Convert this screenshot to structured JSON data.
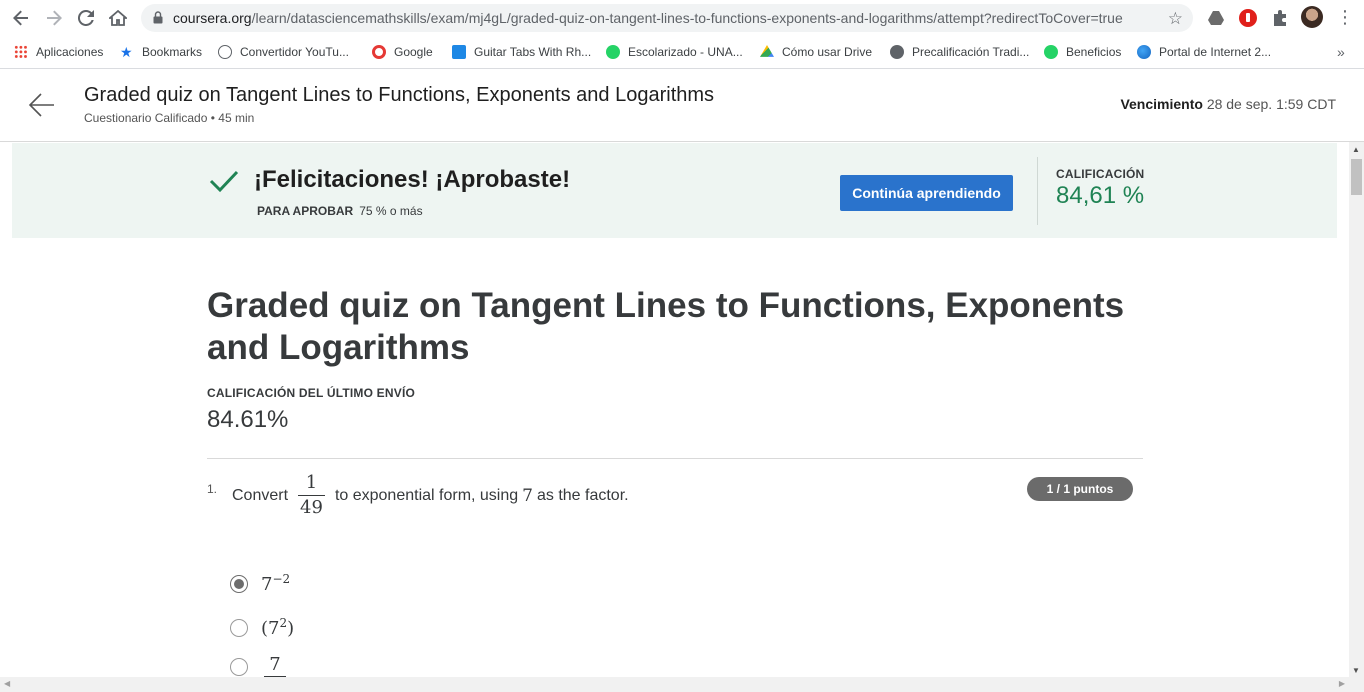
{
  "browser": {
    "url_domain": "coursera.org",
    "url_path": "/learn/datasciencemathskills/exam/mj4gL/graded-quiz-on-tangent-lines-to-functions-exponents-and-logarithms/attempt?redirectToCover=true"
  },
  "bookmarks": [
    {
      "label": "Aplicaciones",
      "icon": "apps-grid-icon",
      "color": "#4285f4"
    },
    {
      "label": "Bookmarks",
      "icon": "star-icon",
      "color": "#1a73e8"
    },
    {
      "label": "Convertidor YouTu...",
      "icon": "converter-icon",
      "color": "#5f6368"
    },
    {
      "label": "Google",
      "icon": "opera-icon",
      "color": "#e53935"
    },
    {
      "label": "Guitar Tabs With Rh...",
      "icon": "tabs-icon",
      "color": "#1e88e5"
    },
    {
      "label": "Escolarizado - UNA...",
      "icon": "whatsapp-icon",
      "color": "#25d366"
    },
    {
      "label": "Cómo usar Drive",
      "icon": "drive-icon",
      "color": "#fbbc04"
    },
    {
      "label": "Precalificación Tradi...",
      "icon": "globe-icon",
      "color": "#5f6368"
    },
    {
      "label": "Beneficios",
      "icon": "whatsapp-icon",
      "color": "#25d366"
    },
    {
      "label": "Portal de Internet 2...",
      "icon": "earth-icon",
      "color": "#1e88e5"
    }
  ],
  "header": {
    "title": "Graded quiz on Tangent Lines to Functions, Exponents and Logarithms",
    "subtitle": "Cuestionario Calificado • 45 min",
    "due_label": "Vencimiento",
    "due_value": "28 de sep. 1:59 CDT"
  },
  "banner": {
    "title": "¡Felicitaciones! ¡Aprobaste!",
    "pass_label": "PARA APROBAR",
    "pass_value": "75 % o más",
    "button": "Continúa aprendiendo",
    "grade_label": "CALIFICACIÓN",
    "grade_value": "84,61 %",
    "accent": "#1f8354",
    "button_color": "#2a73cc"
  },
  "quiz": {
    "title": "Graded quiz on Tangent Lines to Functions, Exponents and Logarithms",
    "last_label": "CALIFICACIÓN DEL ÚLTIMO ENVÍO",
    "last_value": "84.61%"
  },
  "question": {
    "number": "1.",
    "text_before": "Convert",
    "frac_num": "1",
    "frac_den": "49",
    "text_middle": "to exponential form, using",
    "factor": "7",
    "text_after": "as the factor.",
    "points": "1 / 1 puntos",
    "options": [
      {
        "base": "7",
        "exp": "−2",
        "checked": true
      },
      {
        "base": "(7",
        "exp": "2",
        "close": ")",
        "checked": false
      },
      {
        "frac_num": "7",
        "checked": false
      }
    ]
  }
}
